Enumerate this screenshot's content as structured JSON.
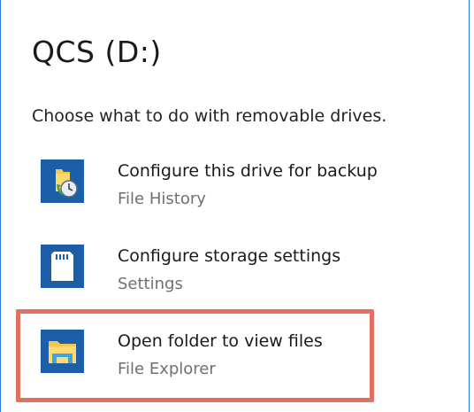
{
  "dialog": {
    "title": "QCS (D:)",
    "prompt": "Choose what to do with removable drives."
  },
  "options": [
    {
      "label": "Configure this drive for backup",
      "sublabel": "File History",
      "icon": "file-history-icon"
    },
    {
      "label": "Configure storage settings",
      "sublabel": "Settings",
      "icon": "sd-card-icon"
    },
    {
      "label": "Open folder to view files",
      "sublabel": "File Explorer",
      "icon": "file-explorer-icon"
    }
  ],
  "colors": {
    "tile_blue": "#1c5fa8",
    "panel_border": "#2b7ad2",
    "highlight": "#e07062",
    "secondary_text": "#707070"
  }
}
